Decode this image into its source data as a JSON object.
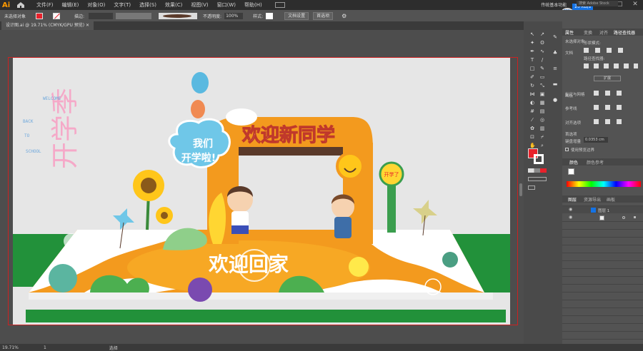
{
  "menubar": {
    "logo": "Ai",
    "items": [
      "文件(F)",
      "编辑(E)",
      "对象(O)",
      "文字(T)",
      "选择(S)",
      "效果(C)",
      "视图(V)",
      "窗口(W)",
      "帮助(H)"
    ],
    "workspace_label": "传统基本功能",
    "search_placeholder": "搜索 Adobe Stock",
    "network_speed": "20 KB/s",
    "network_percent": "76%"
  },
  "controlbar": {
    "selection_label": "未选择对象",
    "stroke_label": "描边:",
    "opacity_label": "不透明度:",
    "opacity_value": "100%",
    "style_label": "样式:",
    "doc_setup_button": "文档设置",
    "preferences_button": "首选项"
  },
  "document": {
    "tab_title": "设计图.ai @ 19.71% (CMYK/GPU 预览)"
  },
  "artwork": {
    "arch_title": "欢迎新同学",
    "badge_line1": "我们",
    "badge_line2": "开学啦!",
    "floor_text": "欢迎回家",
    "side_title": "开学季",
    "side_small_top": "WELCOME",
    "side_small_mid": "BACK",
    "side_small_to": "TO",
    "side_small_bottom": "SCHOOL",
    "thermometer_label": "开学了"
  },
  "status": {
    "zoom": "19.71%",
    "page": "1",
    "tool_name": "选择"
  },
  "panel": {
    "tabs": [
      "属性",
      "变换",
      "对齐",
      "路径查找器"
    ],
    "section_no_selection": "未选择对象",
    "doc_label": "文档",
    "shape_modes": "形状模式:",
    "pathfinder_label": "路径查找器:",
    "extend_button": "扩展",
    "artboard_label": "画板",
    "ruler_grid": "标尺与网格",
    "guides": "参考线",
    "snap": "对齐选项",
    "preferences": "首选项",
    "keyboard_increment": "键盘增量",
    "increment_value": "0.0353 cm",
    "use_preview_bounds": "使用预览边界",
    "color_tabs": [
      "颜色",
      "颜色参考"
    ],
    "layer_tabs": [
      "图层",
      "资源导出",
      "画板"
    ],
    "layer_name": "图层 1"
  },
  "colors": {
    "accent_blue": "#1473e6",
    "fill_red": "#e8212b",
    "orange": "#f39a1e",
    "green": "#22913a"
  }
}
